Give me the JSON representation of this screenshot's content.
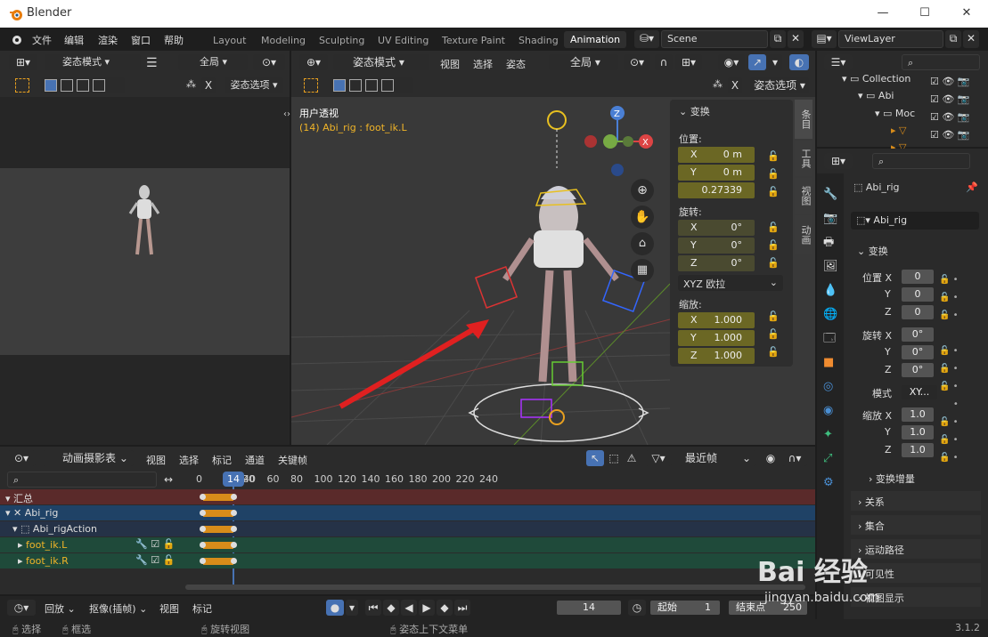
{
  "window": {
    "title": "Blender"
  },
  "menu": [
    "文件",
    "编辑",
    "渲染",
    "窗口",
    "帮助"
  ],
  "workspaces": [
    "Layout",
    "Modeling",
    "Sculpting",
    "UV Editing",
    "Texture Paint",
    "Shading",
    "Animation"
  ],
  "active_workspace": "Animation",
  "scene": {
    "label": "Scene",
    "view_layer": "ViewLayer"
  },
  "left_view": {
    "mode": "姿态模式",
    "transform": "全局",
    "pose_options": "姿态选项"
  },
  "main_view": {
    "mode": "姿态模式",
    "menus": [
      "视图",
      "选择",
      "姿态"
    ],
    "transform": "全局",
    "pose_options": "姿态选项",
    "overlay_title": "用户透视",
    "overlay_subtitle": "(14) Abi_rig : foot_ik.L",
    "side_tabs": [
      "条目",
      "工具",
      "视图",
      "动画"
    ]
  },
  "npanel": {
    "header": "变换",
    "location_label": "位置:",
    "location": [
      {
        "axis": "X",
        "value": "0 m"
      },
      {
        "axis": "Y",
        "value": "0 m"
      },
      {
        "axis": "",
        "value": "0.27339"
      }
    ],
    "rotation_label": "旋转:",
    "rotation": [
      {
        "axis": "X",
        "value": "0°"
      },
      {
        "axis": "Y",
        "value": "0°"
      },
      {
        "axis": "Z",
        "value": "0°"
      }
    ],
    "rotation_mode": "XYZ 欧拉",
    "scale_label": "缩放:",
    "scale": [
      {
        "axis": "X",
        "value": "1.000"
      },
      {
        "axis": "Y",
        "value": "1.000"
      },
      {
        "axis": "Z",
        "value": "1.000"
      }
    ]
  },
  "outliner": {
    "items": [
      {
        "label": "Collection"
      },
      {
        "label": "Abi"
      },
      {
        "label": "Moc"
      }
    ]
  },
  "properties": {
    "object_name": "Abi_rig",
    "data_name": "Abi_rig",
    "transform_header": "变换",
    "loc_label": "位置 X",
    "loc": [
      "0",
      "0",
      "0"
    ],
    "rot_label": "旋转 X",
    "rot": [
      "0°",
      "0°",
      "0°"
    ],
    "mode_label": "模式",
    "mode_value": "XY...",
    "scale_label": "缩放 X",
    "scale": [
      "1.0",
      "1.0",
      "1.0"
    ],
    "delta": "变换增量",
    "sections": [
      "关系",
      "集合",
      "运动路径",
      "可见性",
      "视图显示"
    ],
    "y": "Y",
    "z": "Z"
  },
  "dopesheet": {
    "editor": "动画摄影表",
    "menus": [
      "视图",
      "选择",
      "标记",
      "通道",
      "关键帧"
    ],
    "snap": "最近帧",
    "frame_ticks": [
      "0",
      "20",
      "40",
      "60",
      "80",
      "100",
      "120",
      "140",
      "160",
      "180",
      "200",
      "220",
      "240"
    ],
    "current_frame": "14",
    "channels": [
      {
        "label": "汇总",
        "color": "#5a2a2a"
      },
      {
        "label": "Abi_rig",
        "color": "#1f4266"
      },
      {
        "label": "Abi_rigAction",
        "color": "#253247"
      },
      {
        "label": "foot_ik.L",
        "color": "#1f4a3a"
      },
      {
        "label": "foot_ik.R",
        "color": "#1f4a3a"
      }
    ]
  },
  "playback": {
    "playback": "回放",
    "keying": "抠像(插帧)",
    "view": "视图",
    "marker": "标记",
    "frame": "14",
    "start_label": "起始",
    "start": "1",
    "end_label": "结束点",
    "end": "250"
  },
  "statusbar": {
    "select": "选择",
    "box": "框选",
    "rotate": "旋转视图",
    "context": "姿态上下文菜单",
    "version": "3.1.2"
  },
  "watermark": {
    "brand": "Bai 经验",
    "url": "jingyan.baidu.com"
  },
  "colors": {
    "accent": "#4772b3",
    "select": "#f0a030",
    "key": "#d88c1a"
  }
}
